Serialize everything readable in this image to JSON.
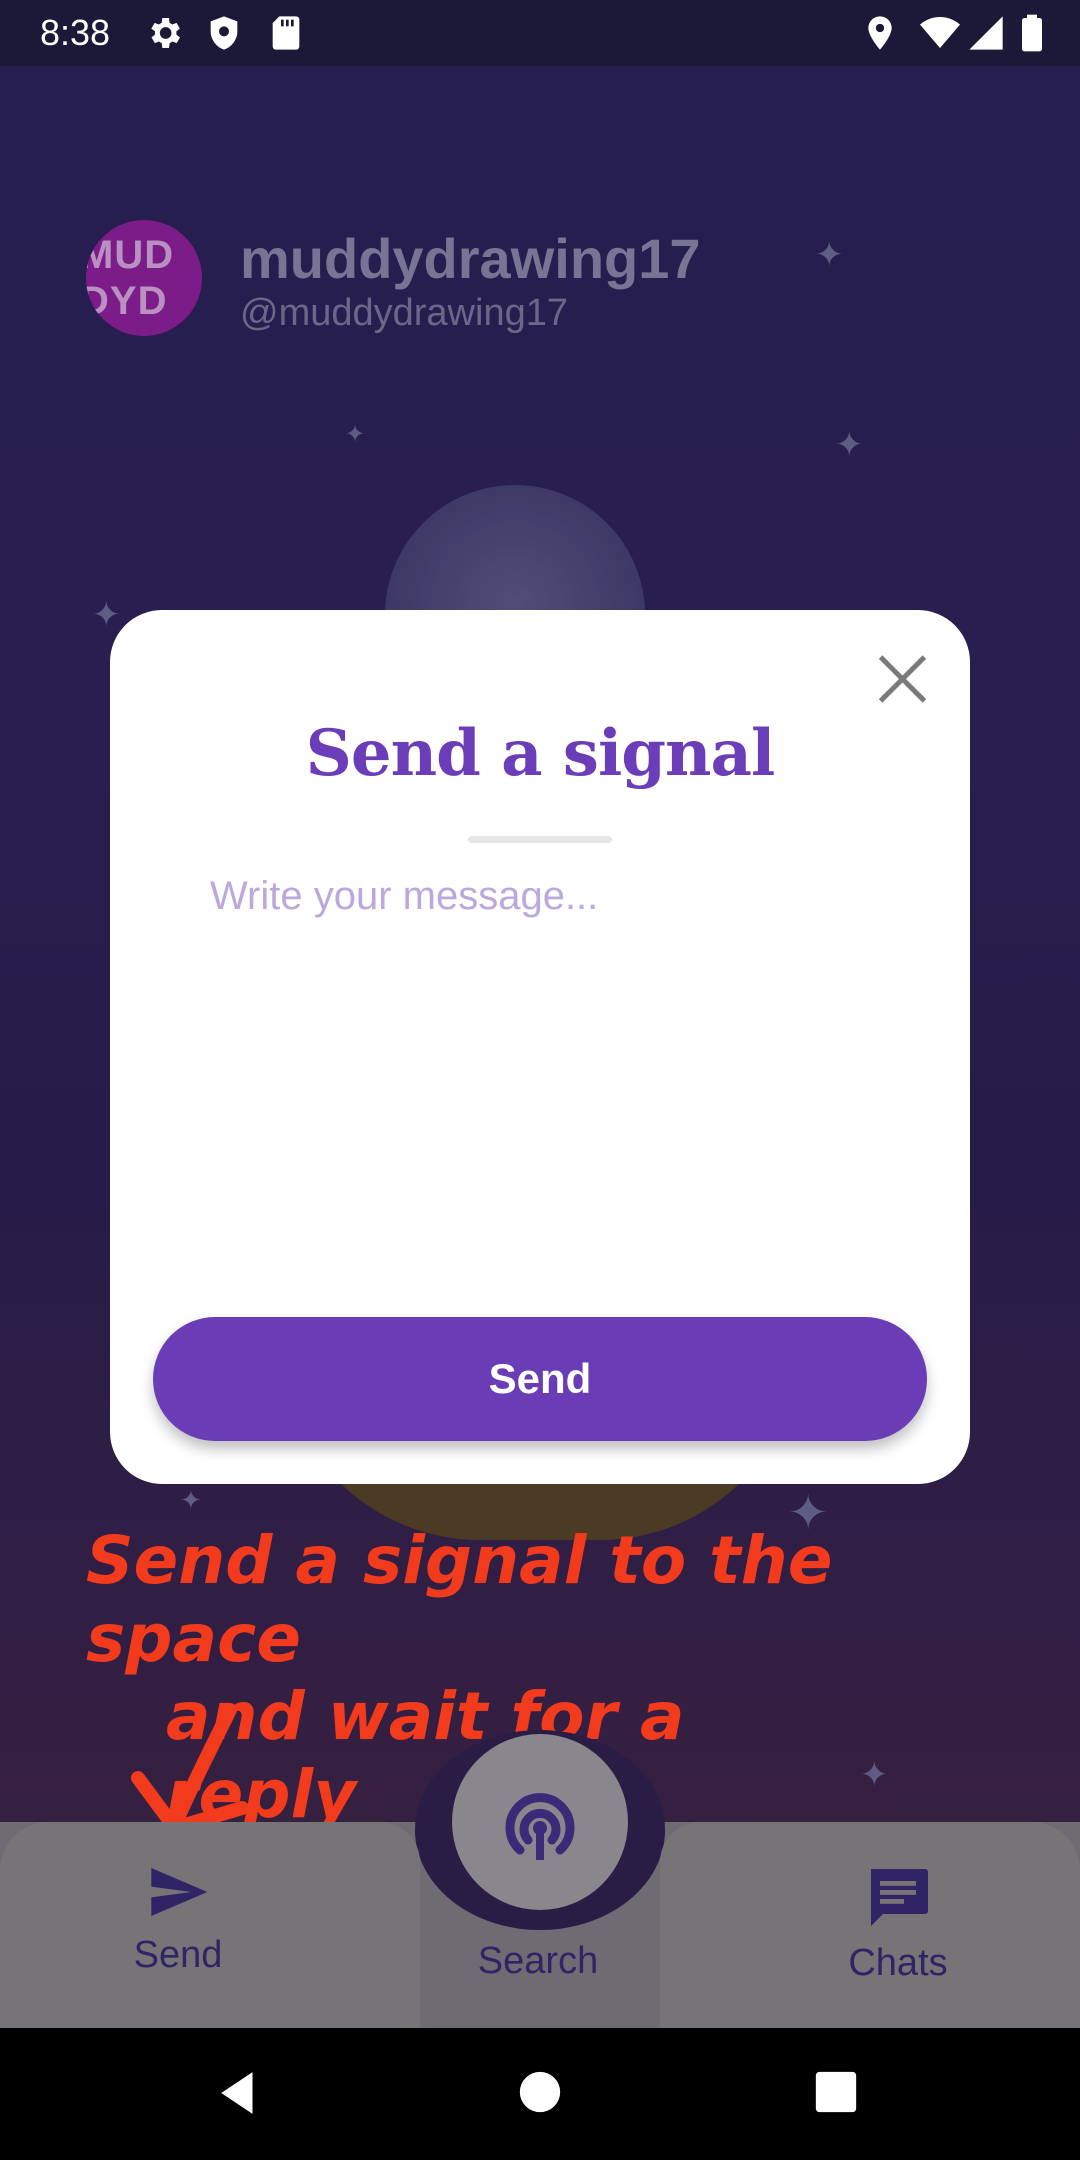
{
  "status_bar": {
    "time": "8:38",
    "icons": [
      "gear-icon",
      "shield-icon",
      "sd-card-icon",
      "location-icon",
      "wifi-icon",
      "signal-icon",
      "battery-icon"
    ]
  },
  "profile": {
    "avatar_text_line1": "MUD",
    "avatar_text_line2": "DYD",
    "name": "muddydrawing17",
    "handle": "@muddydrawing17"
  },
  "modal": {
    "title": "Send a signal",
    "message_placeholder": "Write your message...",
    "message_value": "",
    "send_label": "Send"
  },
  "annotation": {
    "line1": "Send a signal to the space",
    "line2": "and wait for a reply"
  },
  "bottom_nav": {
    "send_label": "Send",
    "search_label": "Search",
    "chats_label": "Chats"
  },
  "colors": {
    "accent": "#6a3db7",
    "annotation": "#f23a1c"
  }
}
